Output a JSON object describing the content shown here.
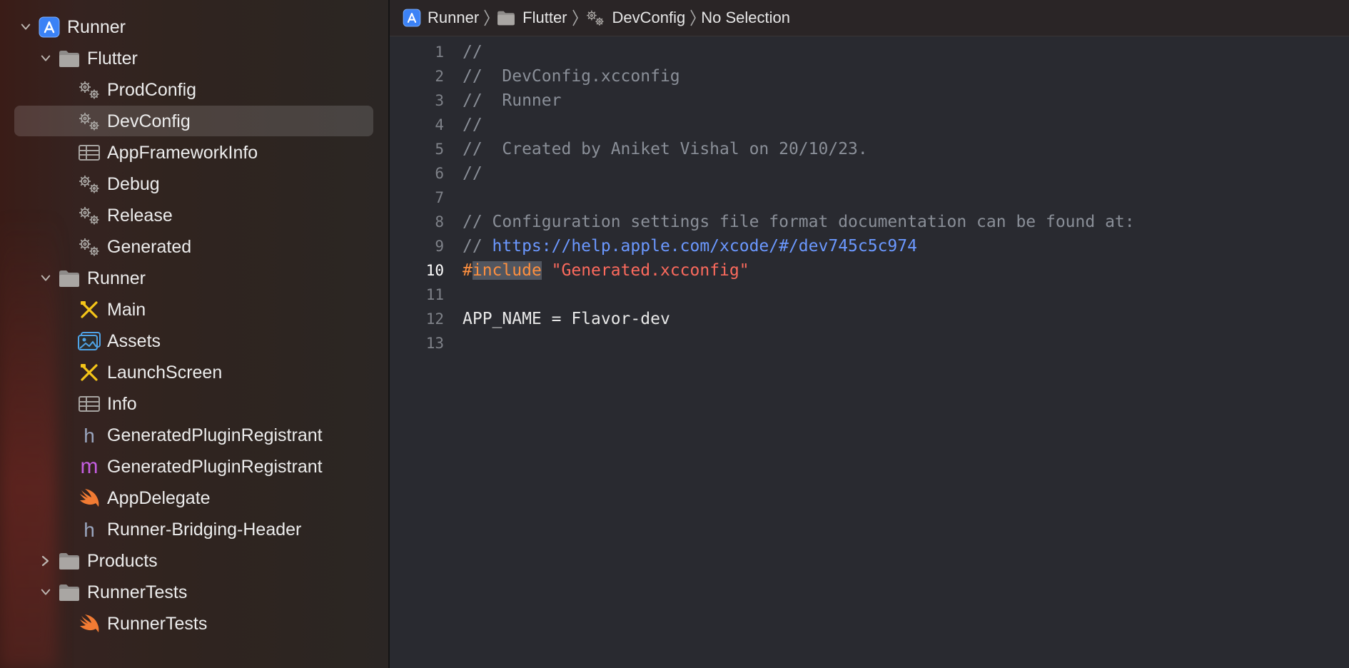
{
  "navigator": {
    "items": [
      {
        "label": "Runner",
        "icon": "xcode-project-icon",
        "indent": 0,
        "chevron": "down"
      },
      {
        "label": "Flutter",
        "icon": "folder-icon",
        "indent": 1,
        "chevron": "down"
      },
      {
        "label": "ProdConfig",
        "icon": "gears-icon",
        "indent": 2
      },
      {
        "label": "DevConfig",
        "icon": "gears-icon",
        "indent": 2,
        "selected": true
      },
      {
        "label": "AppFrameworkInfo",
        "icon": "plist-icon",
        "indent": 2
      },
      {
        "label": "Debug",
        "icon": "gears-icon",
        "indent": 2
      },
      {
        "label": "Release",
        "icon": "gears-icon",
        "indent": 2
      },
      {
        "label": "Generated",
        "icon": "gears-icon",
        "indent": 2
      },
      {
        "label": "Runner",
        "icon": "folder-icon",
        "indent": 1,
        "chevron": "down"
      },
      {
        "label": "Main",
        "icon": "storyboard-icon",
        "indent": 2
      },
      {
        "label": "Assets",
        "icon": "asset-catalog-icon",
        "indent": 2
      },
      {
        "label": "LaunchScreen",
        "icon": "storyboard-icon",
        "indent": 2
      },
      {
        "label": "Info",
        "icon": "plist-icon",
        "indent": 2
      },
      {
        "label": "GeneratedPluginRegistrant",
        "icon": "header-file-icon",
        "indent": 2
      },
      {
        "label": "GeneratedPluginRegistrant",
        "icon": "objc-file-icon",
        "indent": 2
      },
      {
        "label": "AppDelegate",
        "icon": "swift-icon",
        "indent": 2
      },
      {
        "label": "Runner-Bridging-Header",
        "icon": "header-file-icon",
        "indent": 2
      },
      {
        "label": "Products",
        "icon": "folder-icon",
        "indent": 1,
        "chevron": "right"
      },
      {
        "label": "RunnerTests",
        "icon": "folder-icon",
        "indent": 1,
        "chevron": "down"
      },
      {
        "label": "RunnerTests",
        "icon": "swift-icon",
        "indent": 2
      }
    ]
  },
  "jumpbar": {
    "crumbs": [
      {
        "label": "Runner",
        "icon": "xcode-project-icon"
      },
      {
        "label": "Flutter",
        "icon": "folder-icon"
      },
      {
        "label": "DevConfig",
        "icon": "gears-icon"
      },
      {
        "label": "No Selection",
        "icon": ""
      }
    ]
  },
  "editor": {
    "current_line": 10,
    "lines": [
      {
        "n": "1",
        "segments": [
          {
            "t": "//",
            "c": "comment"
          }
        ]
      },
      {
        "n": "2",
        "segments": [
          {
            "t": "//  DevConfig.xcconfig",
            "c": "comment"
          }
        ]
      },
      {
        "n": "3",
        "segments": [
          {
            "t": "//  Runner",
            "c": "comment"
          }
        ]
      },
      {
        "n": "4",
        "segments": [
          {
            "t": "//",
            "c": "comment"
          }
        ]
      },
      {
        "n": "5",
        "segments": [
          {
            "t": "//  Created by Aniket Vishal on 20/10/23.",
            "c": "comment"
          }
        ]
      },
      {
        "n": "6",
        "segments": [
          {
            "t": "//",
            "c": "comment"
          }
        ]
      },
      {
        "n": "7",
        "segments": []
      },
      {
        "n": "8",
        "segments": [
          {
            "t": "// Configuration settings file format documentation can be found at:",
            "c": "comment"
          }
        ]
      },
      {
        "n": "9",
        "segments": [
          {
            "t": "// ",
            "c": "comment"
          },
          {
            "t": "https://help.apple.com/xcode/#/dev745c5c974",
            "c": "url"
          }
        ]
      },
      {
        "n": "10",
        "segments": [
          {
            "t": "#",
            "c": "pre"
          },
          {
            "t": "include",
            "c": "kw"
          },
          {
            "t": " ",
            "c": "plain"
          },
          {
            "t": "\"Generated.xcconfig\"",
            "c": "str"
          }
        ]
      },
      {
        "n": "11",
        "segments": []
      },
      {
        "n": "12",
        "segments": [
          {
            "t": "APP_NAME = Flavor-dev",
            "c": "plain"
          }
        ]
      },
      {
        "n": "13",
        "segments": []
      }
    ]
  },
  "colors": {
    "comment": "#8a8f98",
    "url": "#6b98ff",
    "preprocessor": "#fd8f3f",
    "string": "#fc6a5d",
    "plain": "#e8e8e8"
  }
}
